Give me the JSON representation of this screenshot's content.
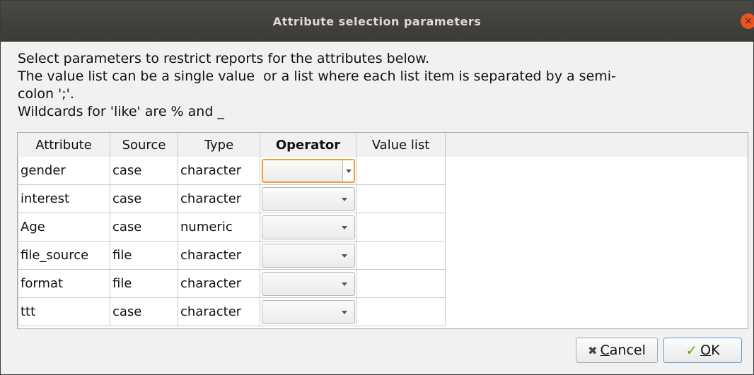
{
  "window": {
    "title": "Attribute selection parameters",
    "close_glyph": "×"
  },
  "instructions": {
    "line1": "Select parameters to restrict reports for the attributes below.",
    "line2": "The value list can be a single value  or a list where each list item is separated by a semi-",
    "line3": "colon ';'.",
    "line4": "Wildcards for 'like' are % and _"
  },
  "table": {
    "headers": [
      "Attribute",
      "Source",
      "Type",
      "Operator",
      "Value list"
    ],
    "rows": [
      {
        "attribute": "gender",
        "source": "case",
        "type": "character",
        "operator": "",
        "value_list": ""
      },
      {
        "attribute": "interest",
        "source": "case",
        "type": "character",
        "operator": "",
        "value_list": ""
      },
      {
        "attribute": "Age",
        "source": "case",
        "type": "numeric",
        "operator": "",
        "value_list": ""
      },
      {
        "attribute": "file_source",
        "source": "file",
        "type": "character",
        "operator": "",
        "value_list": ""
      },
      {
        "attribute": "format",
        "source": "file",
        "type": "character",
        "operator": "",
        "value_list": ""
      },
      {
        "attribute": "ttt",
        "source": "case",
        "type": "character",
        "operator": "",
        "value_list": ""
      }
    ]
  },
  "buttons": {
    "cancel": {
      "glyph": "✖",
      "accel": "C",
      "rest": "ancel",
      "icon": "x-icon"
    },
    "ok": {
      "glyph": "✓",
      "accel": "O",
      "rest": "K",
      "icon": "checkmark-icon"
    }
  },
  "colors": {
    "titlebar": "#3b3a36",
    "close": "#e95420",
    "focus": "#f0a030",
    "ok_border": "#6a96d0"
  }
}
